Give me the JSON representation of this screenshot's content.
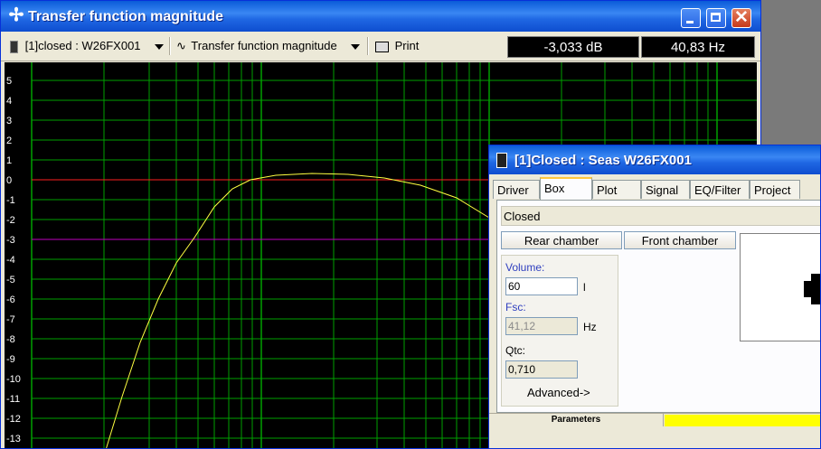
{
  "window": {
    "title": "Transfer function magnitude",
    "controls": {
      "close_label": "✕"
    }
  },
  "toolbar": {
    "project_select": "[1]closed : W26FX001",
    "graph_select": "Transfer function magnitude",
    "print_label": "Print",
    "readout_db": "-3,033 dB",
    "readout_hz": "40,83 Hz"
  },
  "plot": {
    "y_ticks": [
      "5",
      "4",
      "3",
      "2",
      "1",
      "0",
      "-1",
      "-2",
      "-3",
      "-4",
      "-5",
      "-6",
      "-7",
      "-8",
      "-9",
      "-10",
      "-11",
      "-12",
      "-13"
    ],
    "colors": {
      "background": "#000000",
      "grid": "#00a000",
      "curve": "#ffff40",
      "zero_line": "#ff2020",
      "minus3_line": "#c000c0"
    }
  },
  "dialog": {
    "title": "[1]Closed : Seas W26FX001",
    "tabs": [
      "Driver",
      "Box",
      "Plot",
      "Signal",
      "EQ/Filter",
      "Project"
    ],
    "active_tab": "Box",
    "box_type": "Closed",
    "rear_chamber_label": "Rear chamber",
    "front_chamber_label": "Front chamber",
    "volume_label": "Volume:",
    "volume_value": "60",
    "volume_unit": "l",
    "fsc_label": "Fsc:",
    "fsc_value": "41,12",
    "fsc_unit": "Hz",
    "qtc_label": "Qtc:",
    "qtc_value": "0,710",
    "advanced_label": "Advanced->",
    "status_label": "Parameters"
  }
}
